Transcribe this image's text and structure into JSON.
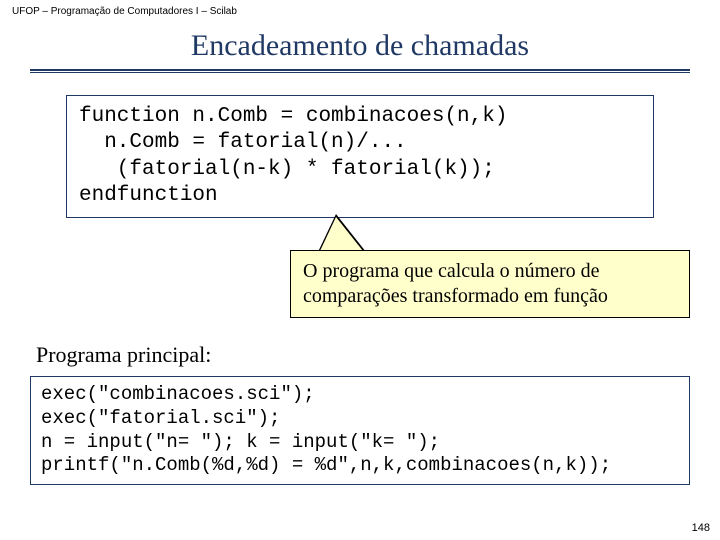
{
  "header": "UFOP – Programação de Computadores I – Scilab",
  "title": "Encadeamento de chamadas",
  "code1": "function n.Comb = combinacoes(n,k)\n  n.Comb = fatorial(n)/...\n   (fatorial(n-k) * fatorial(k));\nendfunction",
  "callout": "O programa que calcula o número de comparações transformado em função",
  "section_label": "Programa principal:",
  "code2": "exec(\"combinacoes.sci\");\nexec(\"fatorial.sci\");\nn = input(\"n= \"); k = input(\"k= \");\nprintf(\"n.Comb(%d,%d) = %d\",n,k,combinacoes(n,k));",
  "page": "148"
}
